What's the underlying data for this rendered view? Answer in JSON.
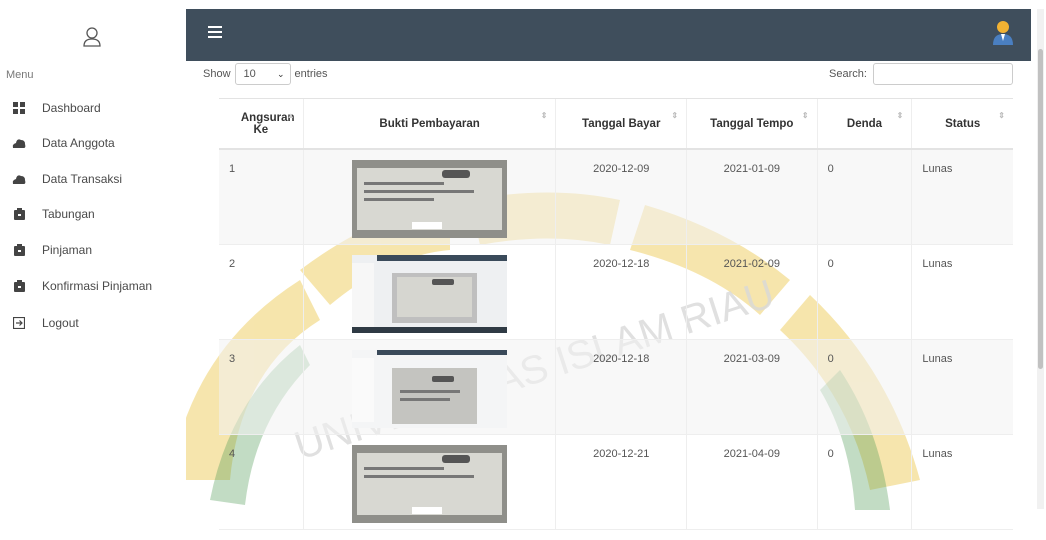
{
  "sidebar": {
    "menu_header": "Menu",
    "items": [
      {
        "label": "Dashboard",
        "icon": "dashboard-icon"
      },
      {
        "label": "Data Anggota",
        "icon": "cloud-icon"
      },
      {
        "label": "Data Transaksi",
        "icon": "cloud-icon"
      },
      {
        "label": "Tabungan",
        "icon": "briefcase-icon"
      },
      {
        "label": "Pinjaman",
        "icon": "briefcase-icon"
      },
      {
        "label": "Konfirmasi Pinjaman",
        "icon": "briefcase-icon"
      },
      {
        "label": "Logout",
        "icon": "logout-icon"
      }
    ]
  },
  "controls": {
    "show_label": "Show",
    "entries_value": "10",
    "entries_label": "entries",
    "search_label": "Search:",
    "search_value": ""
  },
  "table": {
    "headers": [
      "Angsuran Ke",
      "Bukti Pembayaran",
      "Tanggal Bayar",
      "Tanggal Tempo",
      "Denda",
      "Status"
    ],
    "rows": [
      {
        "ke": "1",
        "bayar": "2020-12-09",
        "tempo": "2021-01-09",
        "denda": "0",
        "status": "Lunas"
      },
      {
        "ke": "2",
        "bayar": "2020-12-18",
        "tempo": "2021-02-09",
        "denda": "0",
        "status": "Lunas"
      },
      {
        "ke": "3",
        "bayar": "2020-12-18",
        "tempo": "2021-03-09",
        "denda": "0",
        "status": "Lunas"
      },
      {
        "ke": "4",
        "bayar": "2020-12-21",
        "tempo": "2021-04-09",
        "denda": "0",
        "status": "Lunas"
      }
    ]
  },
  "watermark": {
    "text": "UNIVERSITAS ISLAM RIAU"
  },
  "colors": {
    "topbar": "#3f4e5c",
    "watermark": "#e9c23a",
    "watermark_green": "#2f7d32"
  }
}
